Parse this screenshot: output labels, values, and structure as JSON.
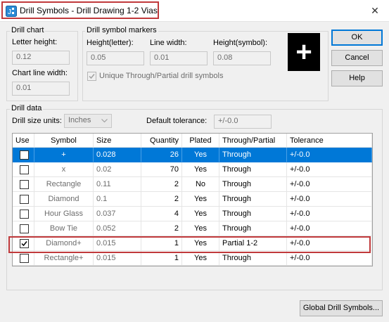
{
  "window": {
    "title": "Drill Symbols - Drill Drawing 1-2 Vias",
    "close_glyph": "✕"
  },
  "drill_chart": {
    "group_label": "Drill chart",
    "letter_height_label": "Letter height:",
    "letter_height_value": "0.12",
    "chart_line_width_label": "Chart line width:",
    "chart_line_width_value": "0.01"
  },
  "markers": {
    "group_label": "Drill symbol markers",
    "height_letter_label": "Height(letter):",
    "height_letter_value": "0.05",
    "line_width_label": "Line width:",
    "line_width_value": "0.01",
    "height_symbol_label": "Height(symbol):",
    "height_symbol_value": "0.08",
    "unique_label": "Unique Through/Partial drill symbols",
    "unique_checked": true,
    "preview_glyph": "+"
  },
  "buttons": {
    "ok": "OK",
    "cancel": "Cancel",
    "help": "Help",
    "global": "Global Drill Symbols..."
  },
  "drill_data": {
    "group_label": "Drill data",
    "size_units_label": "Drill size units:",
    "size_units_value": "Inches",
    "default_tol_label": "Default tolerance:",
    "default_tol_value": "+/-0.0"
  },
  "table": {
    "columns": [
      "Use",
      "Symbol",
      "Size",
      "Quantity",
      "Plated",
      "Through/Partial",
      "Tolerance"
    ],
    "rows": [
      {
        "use": false,
        "symbol": "+",
        "size": "0.028",
        "quantity": "26",
        "plated": "Yes",
        "type": "Through",
        "tolerance": "+/-0.0",
        "selected": true
      },
      {
        "use": false,
        "symbol": "x",
        "size": "0.02",
        "quantity": "70",
        "plated": "Yes",
        "type": "Through",
        "tolerance": "+/-0.0"
      },
      {
        "use": false,
        "symbol": "Rectangle",
        "size": "0.11",
        "quantity": "2",
        "plated": "No",
        "type": "Through",
        "tolerance": "+/-0.0"
      },
      {
        "use": false,
        "symbol": "Diamond",
        "size": "0.1",
        "quantity": "2",
        "plated": "Yes",
        "type": "Through",
        "tolerance": "+/-0.0"
      },
      {
        "use": false,
        "symbol": "Hour Glass",
        "size": "0.037",
        "quantity": "4",
        "plated": "Yes",
        "type": "Through",
        "tolerance": "+/-0.0"
      },
      {
        "use": false,
        "symbol": "Bow Tie",
        "size": "0.052",
        "quantity": "2",
        "plated": "Yes",
        "type": "Through",
        "tolerance": "+/-0.0"
      },
      {
        "use": true,
        "symbol": "Diamond+",
        "size": "0.015",
        "quantity": "1",
        "plated": "Yes",
        "type": "Partial 1-2",
        "tolerance": "+/-0.0"
      },
      {
        "use": false,
        "symbol": "Rectangle+",
        "size": "0.015",
        "quantity": "1",
        "plated": "Yes",
        "type": "Through",
        "tolerance": "+/-0.0"
      }
    ]
  },
  "colors": {
    "selection": "#0078d7",
    "highlight_box": "#c0393b"
  }
}
